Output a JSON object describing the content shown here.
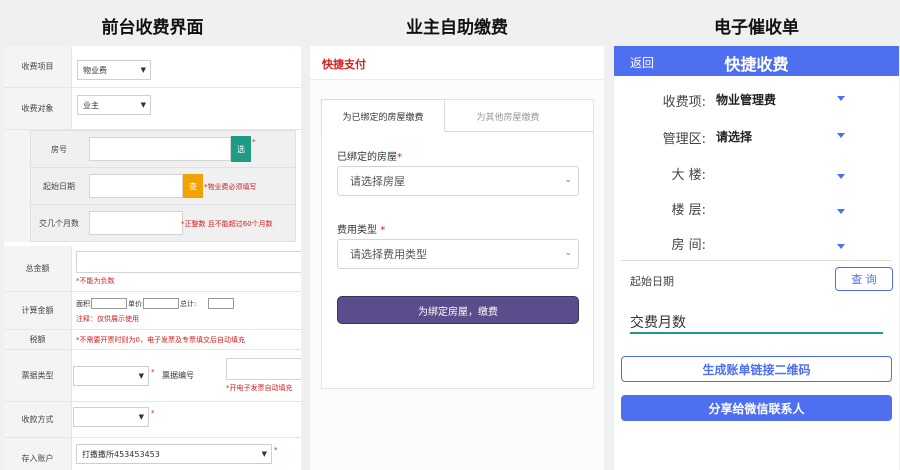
{
  "headings": {
    "front_desk": "前台收费界面",
    "self_pay": "业主自助缴费",
    "e_reminder": "电子催收单"
  },
  "front_desk": {
    "charge_item": {
      "label": "收费项目",
      "value": "物业费"
    },
    "charge_target": {
      "label": "收费对象",
      "value": "业主"
    },
    "room": {
      "label": "房号",
      "pick_button": "选",
      "required_mark": "*"
    },
    "start_date": {
      "label": "起始日期",
      "pick_button": "查",
      "hint": "*物业费必须填写"
    },
    "months": {
      "label": "交几个月数",
      "hint": "*正整数 且不能超过60个月数"
    },
    "total_amount": {
      "label": "总金额",
      "hint": "*不能为负数"
    },
    "calc_amount": {
      "label": "计算金额",
      "area_label": "面积:",
      "unit_price_label": "单价:",
      "subtotal_label": "总计:",
      "note": "注释：仅供展示使用"
    },
    "tax": {
      "label": "税额",
      "hint": "*不需要开票时则为0，电子发票及专票填交后自动填充"
    },
    "invoice_type": {
      "label": "票据类型",
      "number_label": "票据编号",
      "number_hint": "*开电子发票自动填充"
    },
    "payment_method": {
      "label": "收款方式"
    },
    "deposit_account": {
      "label": "存入账户",
      "value": "打撒撒所453453453"
    }
  },
  "self_pay": {
    "title": "快捷支付",
    "tabs": [
      "为已绑定的房屋缴费",
      "为其他房屋缴费"
    ],
    "house_label": "已绑定的房屋",
    "house_placeholder": "请选择房屋",
    "fee_type_label": "费用类型",
    "fee_type_placeholder": "请选择费用类型",
    "required_mark": "*",
    "submit_label": "为绑定房屋，缴费"
  },
  "e_reminder": {
    "back": "返回",
    "title": "快捷收费",
    "fields": [
      {
        "label": "收费项:",
        "value": "物业管理费"
      },
      {
        "label": "管理区:",
        "value": "请选择"
      },
      {
        "label": "大  楼:",
        "value": ""
      },
      {
        "label": "楼  层:",
        "value": ""
      },
      {
        "label": "房  间:",
        "value": ""
      }
    ],
    "start_date_label": "起始日期",
    "query_button": "查 询",
    "months_placeholder": "交费月数",
    "qr_button": "生成账单链接二维码",
    "share_button": "分享给微信联系人"
  },
  "colors": {
    "accent_blue": "#4d6ff0",
    "purple": "#5b4d8c",
    "green": "#1f9a84",
    "orange": "#f1a400",
    "red": "#d42020"
  }
}
